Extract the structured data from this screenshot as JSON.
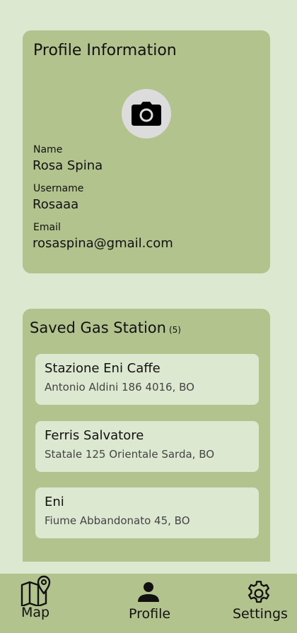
{
  "profile": {
    "title": "Profile Information",
    "avatar_icon": "camera-icon",
    "fields": {
      "name": {
        "label": "Name",
        "value": "Rosa Spina"
      },
      "username": {
        "label": "Username",
        "value": "Rosaaa"
      },
      "email": {
        "label": "Email",
        "value": "rosaspina@gmail.com"
      }
    }
  },
  "saved": {
    "title": "Saved Gas Station",
    "count": "(5)",
    "stations": [
      {
        "name": "Stazione Eni Caffe",
        "address": "Antonio Aldini 186 4016, BO"
      },
      {
        "name": "Ferris Salvatore",
        "address": "Statale 125 Orientale Sarda, BO"
      },
      {
        "name": "Eni",
        "address": "Fiume Abbandonato 45, BO"
      }
    ]
  },
  "nav": {
    "map": {
      "label": "Map",
      "icon": "map-pin-icon"
    },
    "profile": {
      "label": "Profile",
      "icon": "person-icon"
    },
    "settings": {
      "label": "Settings",
      "icon": "gear-icon"
    }
  },
  "colors": {
    "background": "#dde8d0",
    "card": "#b2c38e",
    "avatar_bg": "#dcdcdc"
  }
}
